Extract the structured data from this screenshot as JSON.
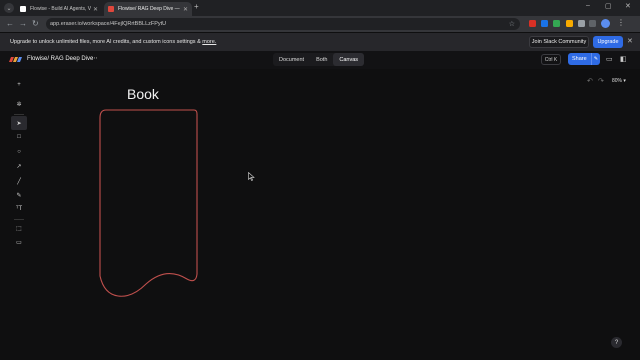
{
  "browser": {
    "tabs": [
      {
        "title": "Flowise - Build AI Agents, Visu...",
        "active": false,
        "favicon_color": "#ffffff"
      },
      {
        "title": "Flowise/ RAG Deep Dive — Boo...",
        "active": true,
        "favicon_color": "#e0473c"
      }
    ],
    "new_tab": "+",
    "url": "app.eraser.io/workspace/4FejlQRrtBBLLzFPytU",
    "window_controls": {
      "minimize": "–",
      "maximize": "▢",
      "close": "✕"
    }
  },
  "banner": {
    "text": "Upgrade to unlock unlimited files, more AI credits, and custom icons settings &",
    "more_link": "more.",
    "slack_button": "Join Slack Community",
    "upgrade_button": "Upgrade"
  },
  "header": {
    "breadcrumb": "Flowise/ RAG Deep Dive",
    "view_tabs": [
      "Document",
      "Both",
      "Canvas"
    ],
    "selected_view": "Canvas",
    "shortcut": "Ctrl K",
    "share_label": "Share",
    "zoom": "80%"
  },
  "canvas": {
    "shape_title": "Book",
    "shape_color": "#c0504d",
    "help": "?"
  },
  "colors": {
    "accent": "#2f6be5",
    "background": "#0f0f10"
  }
}
